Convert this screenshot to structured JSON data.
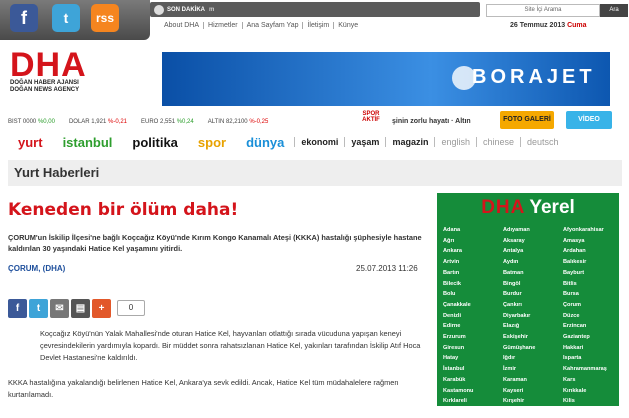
{
  "social": {
    "facebook": "f",
    "twitter": "t",
    "rss": "rss"
  },
  "son_dakika": {
    "label": "SON DAKİKA",
    "suffix": "m"
  },
  "top_links": [
    "About DHA",
    "Hizmetler",
    "Ana Sayfam Yap",
    "İletişim",
    "Künye"
  ],
  "search": {
    "placeholder": "Site İçi Arama",
    "button": "Ara"
  },
  "date": {
    "text": "26 Temmuz 2013",
    "day": "Cuma"
  },
  "logo": {
    "brand": "DHA",
    "line1": "DOĞAN HABER AJANSI",
    "line2": "DOĞAN NEWS AGENCY"
  },
  "banner": {
    "text": "BORAJET"
  },
  "ticker": [
    {
      "name": "BIST",
      "value": "0000",
      "change": "%0,00",
      "dir": "up"
    },
    {
      "name": "DOLAR",
      "value": "1,921",
      "change": "%-0,21",
      "dir": "dn"
    },
    {
      "name": "EURO",
      "value": "2,551",
      "change": "%0,24",
      "dir": "up"
    },
    {
      "name": "ALTIN",
      "value": "82,2100",
      "change": "%-0,25",
      "dir": "dn"
    }
  ],
  "spor_aktif": "SPOR AKTİF",
  "tick_headline": "şinin zorlu hayatı · Altın",
  "foto_galeri": "FOTO GALERİ",
  "video": "VİDEO",
  "nav_main": [
    "yurt",
    "istanbul",
    "politika",
    "spor",
    "dünya"
  ],
  "nav_sub": [
    "ekonomi",
    "yaşam",
    "magazin"
  ],
  "nav_lang": [
    "english",
    "chinese",
    "deutsch"
  ],
  "page_title": "Yurt Haberleri",
  "article": {
    "headline": "Keneden bir ölüm daha!",
    "summary": "ÇORUM'un İskilip İlçesi'ne bağlı Koçcağız Köyü'nde Kırım Kongo Kanamalı Ateşi (KKKA) hastalığı şüphesiyle hastane kaldırılan 30 yaşındaki Hatice Kel yaşamını yitirdi.",
    "source": "ÇORUM, (DHA)",
    "date": "25.07.2013 11:26",
    "share_count": "0",
    "body1": "Koçcağız Köyü'nün Yalak Mahallesi'nde oturan Hatice Kel, hayvanları otlattığı sırada vücuduna yapışan keneyi çevresindekilerin yardımıyla kopardı. Bir müddet sonra rahatsızlanan Hatice Kel, yakınları tarafından İskilip Atıf Hoca Devlet Hastanesi'ne kaldırıldı.",
    "body2": "KKKA hastalığına yakalandığı belirlenen Hatice Kel, Ankara'ya sevk edildi. Ancak, Hatice Kel tüm müdahalelere rağmen kurtarılamadı."
  },
  "yerel": {
    "brand": "DHA",
    "title": "Yerel",
    "cities": [
      "Adana",
      "Adıyaman",
      "Afyonkarahisar",
      "Ağrı",
      "Aksaray",
      "Amasya",
      "Ankara",
      "Antalya",
      "Ardahan",
      "Artvin",
      "Aydın",
      "Balıkesir",
      "Bartın",
      "Batman",
      "Bayburt",
      "Bilecik",
      "Bingöl",
      "Bitlis",
      "Bolu",
      "Burdur",
      "Bursa",
      "Çanakkale",
      "Çankırı",
      "Çorum",
      "Denizli",
      "Diyarbakır",
      "Düzce",
      "Edirne",
      "Elazığ",
      "Erzincan",
      "Erzurum",
      "Eskişehir",
      "Gaziantep",
      "Giresun",
      "Gümüşhane",
      "Hakkari",
      "Hatay",
      "Iğdır",
      "Isparta",
      "İstanbul",
      "İzmir",
      "Kahramanmaraş",
      "Karabük",
      "Karaman",
      "Kars",
      "Kastamonu",
      "Kayseri",
      "Kırıkkale",
      "Kırklareli",
      "Kırşehir",
      "Kilis",
      "Kocaeli",
      "Konya",
      "Kütahya"
    ]
  }
}
